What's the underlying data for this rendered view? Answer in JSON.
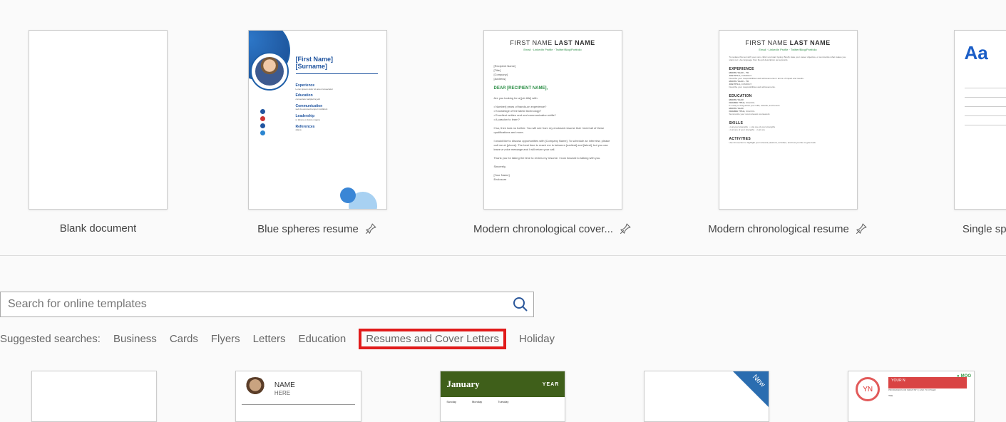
{
  "templates": [
    {
      "label": "Blank document",
      "pinnable": false
    },
    {
      "label": "Blue spheres resume",
      "pinnable": true,
      "thumb": {
        "first_name": "[First Name]",
        "surname": "[Surname]"
      }
    },
    {
      "label": "Modern chronological cover...",
      "pinnable": true,
      "thumb": {
        "title_first": "FIRST NAME ",
        "title_last": "LAST NAME",
        "subline": "Email · LinkedIn Profile · Twitter/Blog/Portfolio",
        "recipient": "DEAR [RECIPIENT NAME],"
      }
    },
    {
      "label": "Modern chronological resume",
      "pinnable": true,
      "thumb": {
        "title_first": "FIRST NAME ",
        "title_last": "LAST NAME",
        "subline": "Email · LinkedIn Profile · Twitter/Blog/Portfolio",
        "sections": [
          "EXPERIENCE",
          "EDUCATION",
          "SKILLS",
          "ACTIVITIES"
        ],
        "jobtitle": "JOB TITLE,",
        "date": "MONTH YEAR – TO",
        "degree": "DEGREE TITLE,"
      }
    },
    {
      "label": "Single spaced (blank)",
      "pinnable": true,
      "thumb": {
        "aa": "Aa"
      }
    }
  ],
  "search": {
    "placeholder": "Search for online templates"
  },
  "suggested": {
    "label": "Suggested searches:",
    "links": [
      "Business",
      "Cards",
      "Flyers",
      "Letters",
      "Education",
      "Resumes and Cover Letters",
      "Holiday"
    ],
    "highlighted_index": 5
  },
  "lower_templates": [
    {
      "kind": "blank"
    },
    {
      "kind": "photo_name",
      "name": "NAME",
      "sub": "HERE"
    },
    {
      "kind": "calendar",
      "month": "January",
      "year": "YEAR"
    },
    {
      "kind": "new_badge",
      "badge": "New"
    },
    {
      "kind": "moo",
      "initials": "YN",
      "name": "YOUR N",
      "brand": "MOO",
      "title": "Title"
    }
  ]
}
